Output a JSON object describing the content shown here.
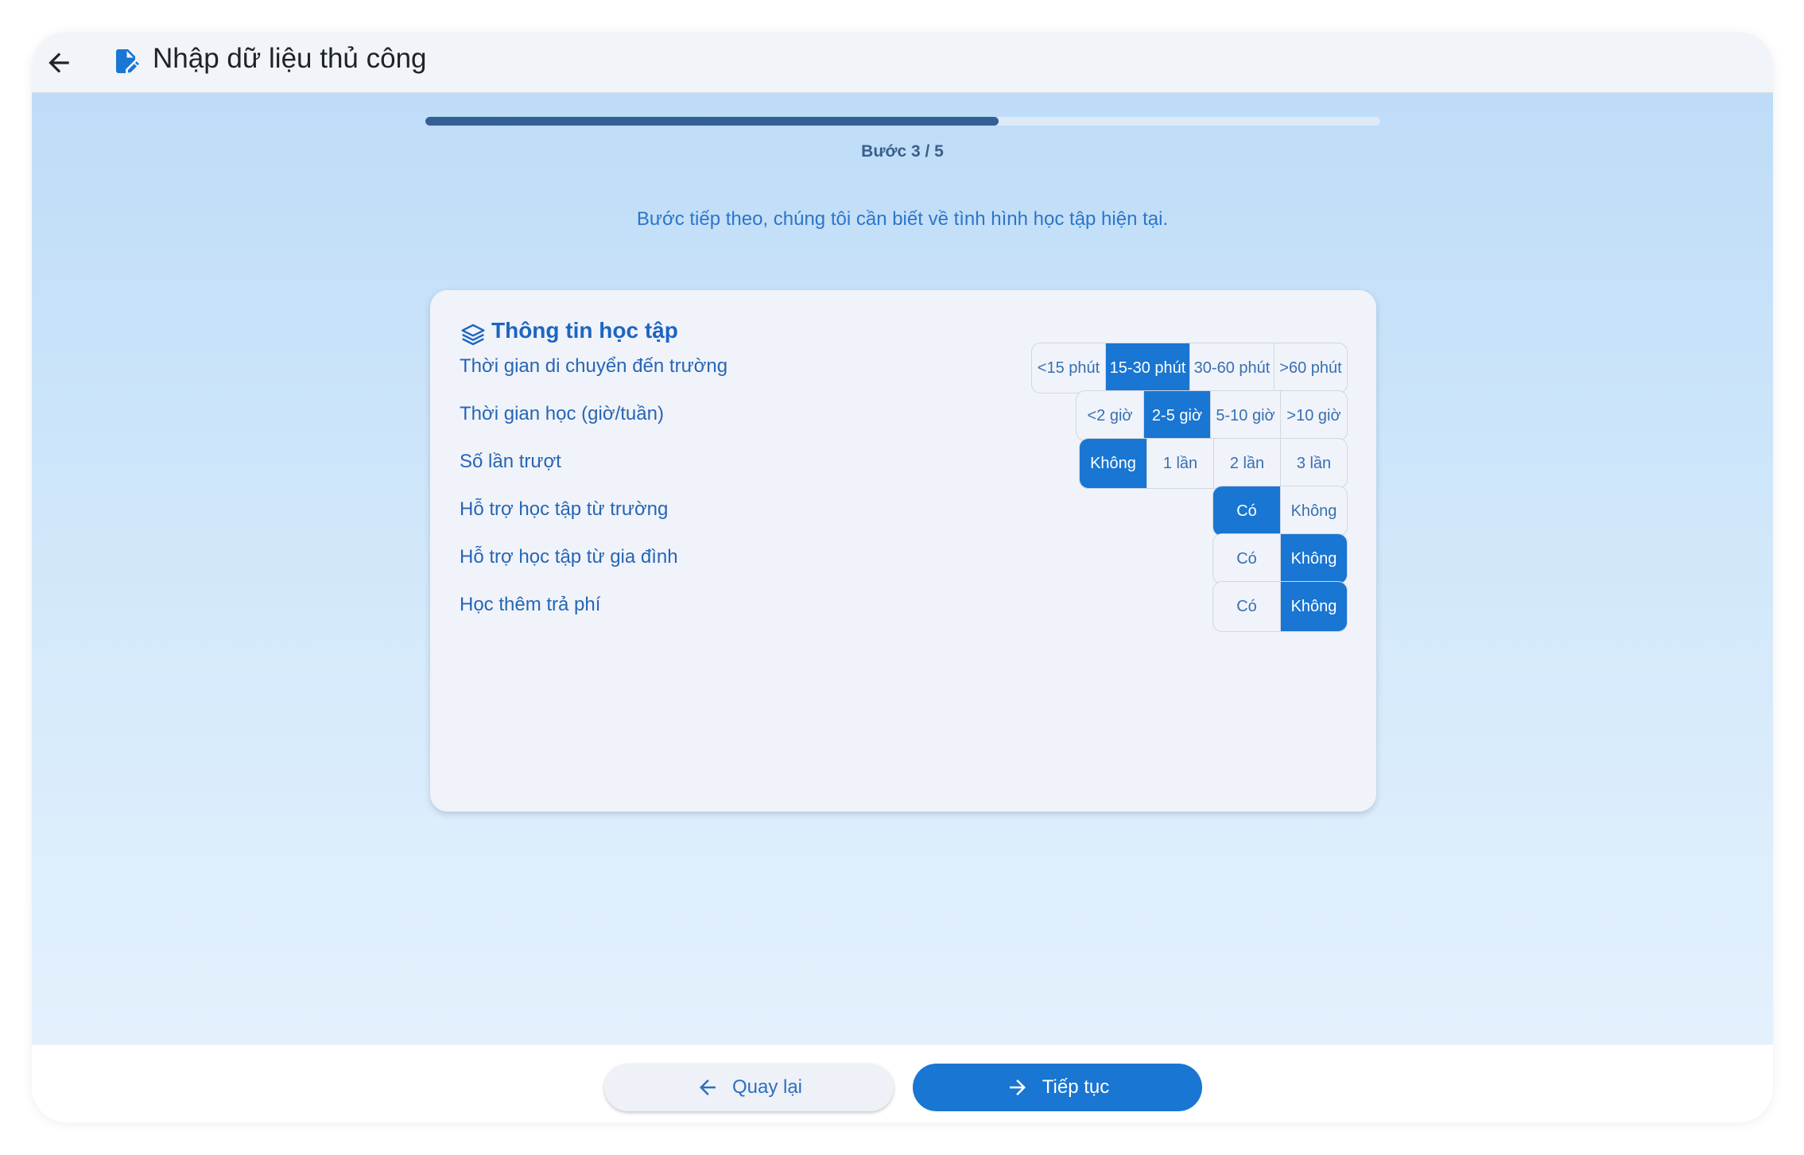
{
  "app_bar": {
    "title": "Nhập dữ liệu thủ công"
  },
  "progress": {
    "step_label": "Bước 3 / 5",
    "current_step": 3,
    "total_steps": 5,
    "fraction": 0.6
  },
  "intro_text": "Bước tiếp theo, chúng tôi cần biết về tình hình học tập hiện tại.",
  "card": {
    "title": "Thông tin học tập",
    "fields": [
      {
        "label": "Thời gian di chuyển đến trường",
        "options": [
          "<15 phút",
          "15-30 phút",
          "30-60 phút",
          ">60 phút"
        ],
        "selected": 1
      },
      {
        "label": "Thời gian học (giờ/tuần)",
        "options": [
          "<2 giờ",
          "2-5 giờ",
          "5-10 giờ",
          ">10 giờ"
        ],
        "selected": 1
      },
      {
        "label": "Số lần trượt",
        "options": [
          "Không",
          "1 lần",
          "2 lần",
          "3 lần"
        ],
        "selected": 0
      },
      {
        "label": "Hỗ trợ học tập từ trường",
        "options": [
          "Có",
          "Không"
        ],
        "selected": 0
      },
      {
        "label": "Hỗ trợ học tập từ gia đình",
        "options": [
          "Có",
          "Không"
        ],
        "selected": 1
      },
      {
        "label": "Học thêm trả phí",
        "options": [
          "Có",
          "Không"
        ],
        "selected": 1
      }
    ]
  },
  "footer": {
    "back_label": "Quay lại",
    "next_label": "Tiếp tục"
  },
  "colors": {
    "accent": "#1976d2",
    "progress": "#345f95",
    "text_blue": "#2566b4"
  }
}
